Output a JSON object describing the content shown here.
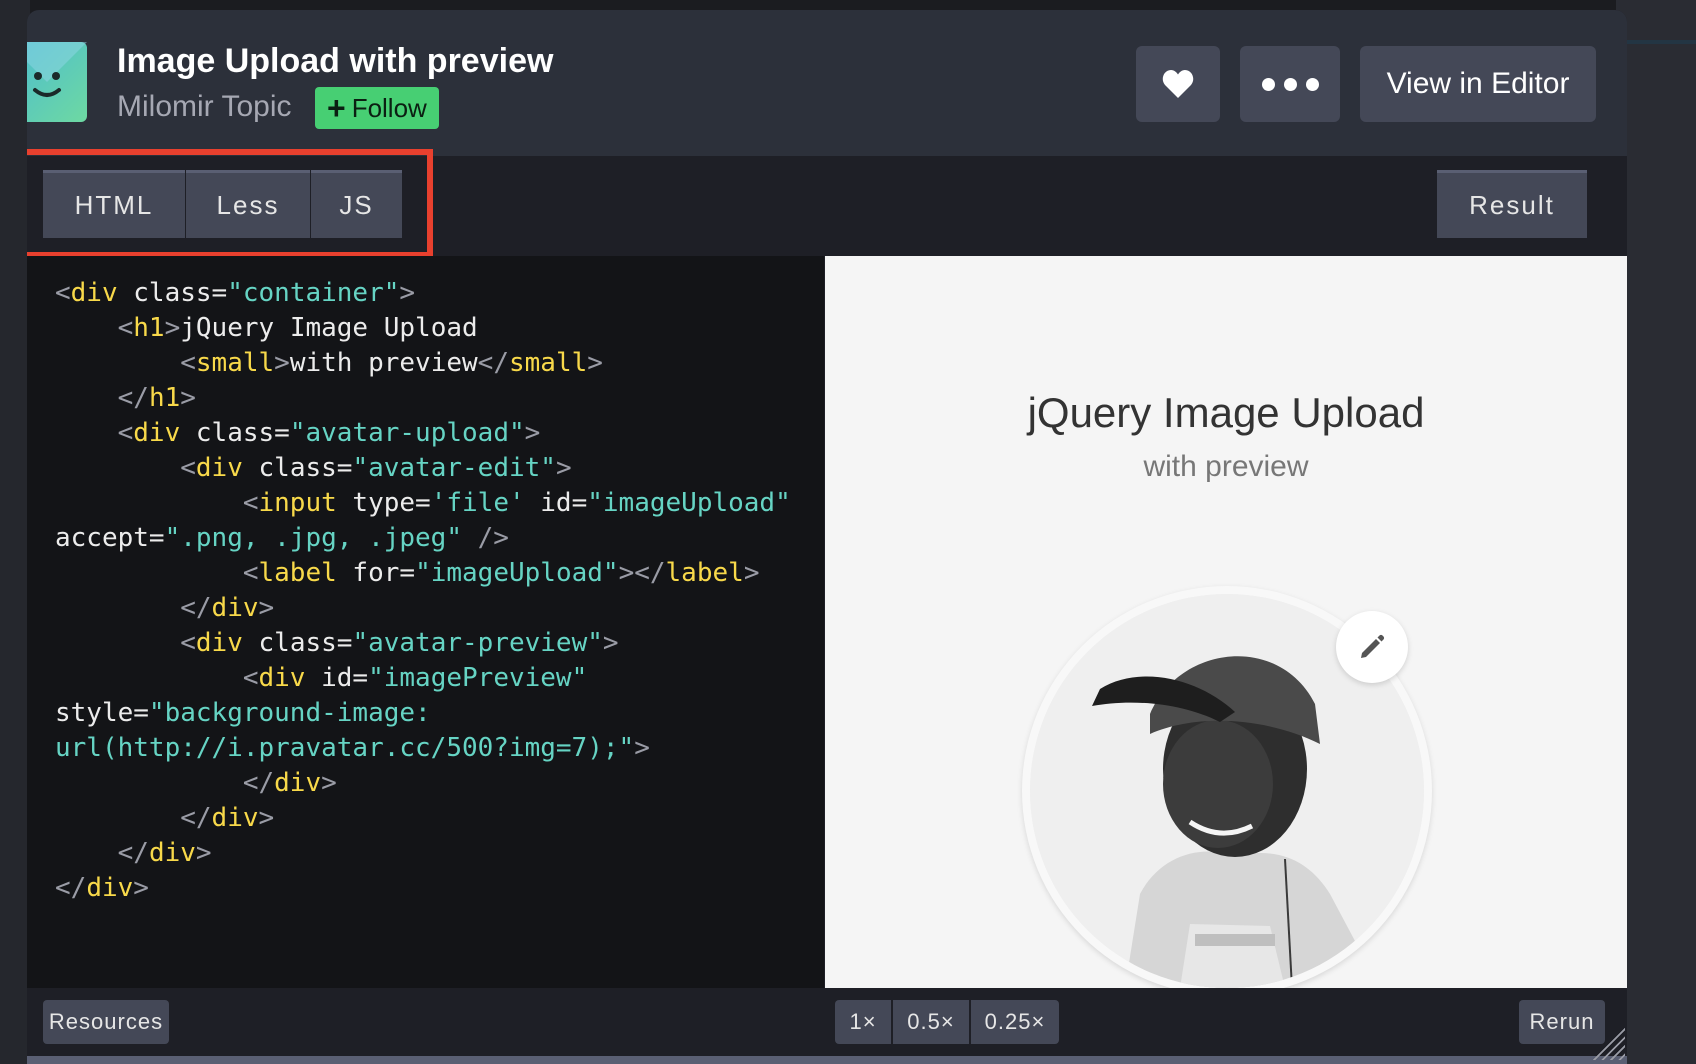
{
  "header": {
    "pen_title": "Image Upload with preview",
    "author": "Milomir Topic",
    "follow_label": "Follow",
    "view_in_editor_label": "View in Editor",
    "heart_icon": "heart-icon",
    "more_icon": "more-dots-icon"
  },
  "tabs": [
    {
      "label": "HTML"
    },
    {
      "label": "Less"
    },
    {
      "label": "JS"
    }
  ],
  "result_tab": {
    "label": "Result"
  },
  "code_lines": [
    {
      "indent": "",
      "parts": [
        [
          "pn",
          "<"
        ],
        [
          "tg",
          "div"
        ],
        [
          "at",
          " class="
        ],
        [
          "vl",
          "\"container\""
        ],
        [
          "pn",
          ">"
        ]
      ]
    },
    {
      "indent": "    ",
      "parts": [
        [
          "pn",
          "<"
        ],
        [
          "tg",
          "h1"
        ],
        [
          "pn",
          ">"
        ],
        [
          "at",
          "jQuery Image Upload"
        ]
      ]
    },
    {
      "indent": "        ",
      "parts": [
        [
          "pn",
          "<"
        ],
        [
          "tg",
          "small"
        ],
        [
          "pn",
          ">"
        ],
        [
          "at",
          "with preview"
        ],
        [
          "pn",
          "</"
        ],
        [
          "tg",
          "small"
        ],
        [
          "pn",
          ">"
        ]
      ]
    },
    {
      "indent": "    ",
      "parts": [
        [
          "pn",
          "</"
        ],
        [
          "tg",
          "h1"
        ],
        [
          "pn",
          ">"
        ]
      ]
    },
    {
      "indent": "    ",
      "parts": [
        [
          "pn",
          "<"
        ],
        [
          "tg",
          "div"
        ],
        [
          "at",
          " class="
        ],
        [
          "vl",
          "\"avatar-upload\""
        ],
        [
          "pn",
          ">"
        ]
      ]
    },
    {
      "indent": "        ",
      "parts": [
        [
          "pn",
          "<"
        ],
        [
          "tg",
          "div"
        ],
        [
          "at",
          " class="
        ],
        [
          "vl",
          "\"avatar-edit\""
        ],
        [
          "pn",
          ">"
        ]
      ]
    },
    {
      "indent": "            ",
      "parts": [
        [
          "pn",
          "<"
        ],
        [
          "tg",
          "input"
        ],
        [
          "at",
          " type="
        ],
        [
          "vl",
          "'file'"
        ],
        [
          "at",
          " id="
        ],
        [
          "vl",
          "\"imageUpload\""
        ]
      ]
    },
    {
      "indent": "",
      "parts": [
        [
          "at",
          "accept="
        ],
        [
          "vl",
          "\".png, .jpg, .jpeg\""
        ],
        [
          "pn",
          " />"
        ]
      ]
    },
    {
      "indent": "            ",
      "parts": [
        [
          "pn",
          "<"
        ],
        [
          "tg",
          "label"
        ],
        [
          "at",
          " for="
        ],
        [
          "vl",
          "\"imageUpload\""
        ],
        [
          "pn",
          "></"
        ],
        [
          "tg",
          "label"
        ],
        [
          "pn",
          ">"
        ]
      ]
    },
    {
      "indent": "        ",
      "parts": [
        [
          "pn",
          "</"
        ],
        [
          "tg",
          "div"
        ],
        [
          "pn",
          ">"
        ]
      ]
    },
    {
      "indent": "        ",
      "parts": [
        [
          "pn",
          "<"
        ],
        [
          "tg",
          "div"
        ],
        [
          "at",
          " class="
        ],
        [
          "vl",
          "\"avatar-preview\""
        ],
        [
          "pn",
          ">"
        ]
      ]
    },
    {
      "indent": "            ",
      "parts": [
        [
          "pn",
          "<"
        ],
        [
          "tg",
          "div"
        ],
        [
          "at",
          " id="
        ],
        [
          "vl",
          "\"imagePreview\""
        ]
      ]
    },
    {
      "indent": "",
      "parts": [
        [
          "at",
          "style="
        ],
        [
          "vl",
          "\"background-image:"
        ]
      ]
    },
    {
      "indent": "",
      "parts": [
        [
          "vl",
          "url(http://i.pravatar.cc/500?img=7);\""
        ],
        [
          "pn",
          ">"
        ]
      ]
    },
    {
      "indent": "            ",
      "parts": [
        [
          "pn",
          "</"
        ],
        [
          "tg",
          "div"
        ],
        [
          "pn",
          ">"
        ]
      ]
    },
    {
      "indent": "        ",
      "parts": [
        [
          "pn",
          "</"
        ],
        [
          "tg",
          "div"
        ],
        [
          "pn",
          ">"
        ]
      ]
    },
    {
      "indent": "    ",
      "parts": [
        [
          "pn",
          "</"
        ],
        [
          "tg",
          "div"
        ],
        [
          "pn",
          ">"
        ]
      ]
    },
    {
      "indent": "",
      "parts": [
        [
          "pn",
          "</"
        ],
        [
          "tg",
          "div"
        ],
        [
          "pn",
          ">"
        ]
      ]
    }
  ],
  "preview": {
    "heading": "jQuery Image Upload",
    "subheading": "with preview",
    "edit_icon": "pencil-icon"
  },
  "footer": {
    "resources_label": "Resources",
    "zoom_options": [
      "1×",
      "0.5×",
      "0.25×"
    ],
    "rerun_label": "Rerun"
  },
  "colors": {
    "follow_green": "#47cf73",
    "highlight_red": "#e8402e",
    "code_tag": "#f8d94a",
    "code_value": "#66d4c4"
  }
}
